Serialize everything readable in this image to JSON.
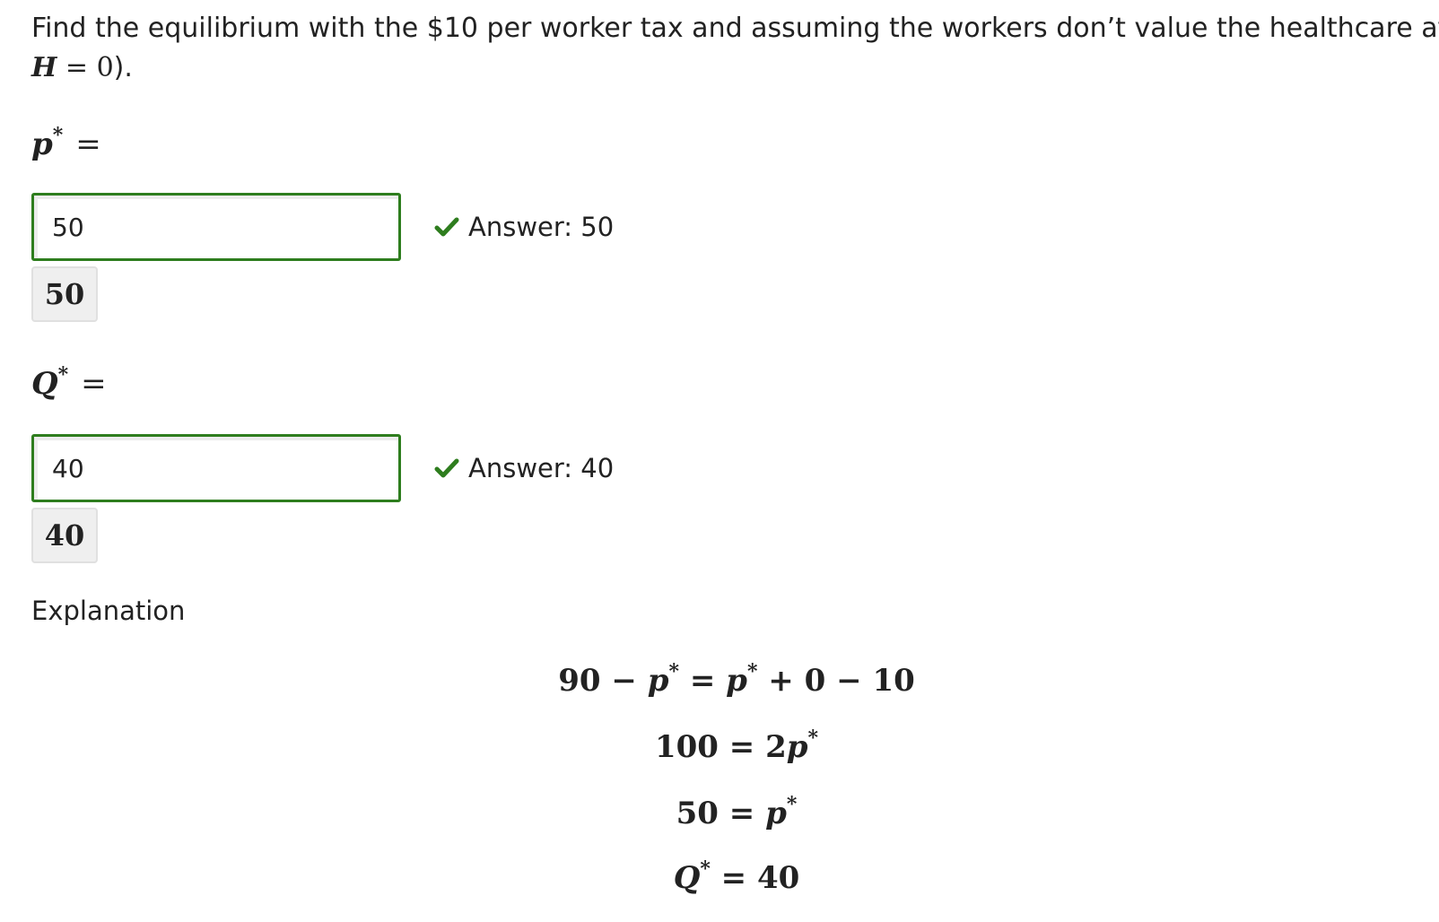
{
  "question": {
    "line1_text": "Find the equilibrium with the $10 per worker tax and assuming the workers don’t value the healthcare at all (",
    "line2_var": "H",
    "line2_eq": " = 0",
    "line2_tail": ")."
  },
  "parts": [
    {
      "symbol": "p",
      "star": "*",
      "equals": "=",
      "input_value": "50",
      "feedback_text": "Answer: 50",
      "preview_value": "50"
    },
    {
      "symbol": "Q",
      "star": "*",
      "equals": "=",
      "input_value": "40",
      "feedback_text": "Answer: 40",
      "preview_value": "40"
    }
  ],
  "explanation": {
    "label": "Explanation",
    "equations": [
      [
        "90 − ",
        "p",
        "*",
        " = ",
        "p",
        "*",
        " + 0 − 10"
      ],
      [
        "100 = 2",
        "p",
        "*"
      ],
      [
        "50 = ",
        "p",
        "*"
      ],
      [
        "Q",
        "*",
        " = 40"
      ]
    ]
  },
  "colors": {
    "correct_border": "#2e7d1e",
    "check": "#2e7d1e",
    "preview_bg": "#efefef"
  },
  "icons": {
    "feedback_icon": "checkmark-icon"
  }
}
